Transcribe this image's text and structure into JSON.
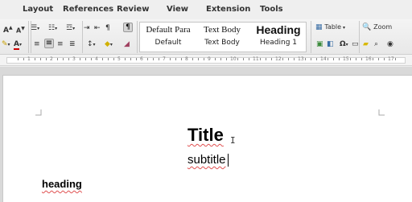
{
  "menubar": {
    "items": [
      "Layout",
      "References",
      "Review",
      "View",
      "Extension",
      "Tools"
    ]
  },
  "toolbar": {
    "font_grow": "A",
    "font_shrink": "A",
    "font_color_label": "A",
    "table_label": "Table",
    "zoom_label": "Zoom",
    "special_char": "Ω",
    "pilcrow": "¶"
  },
  "styles": [
    {
      "preview": "Default Para",
      "name": "Default"
    },
    {
      "preview": "Text Body",
      "name": "Text Body"
    },
    {
      "preview": "Heading",
      "name": "Heading 1"
    }
  ],
  "ruler": {
    "numbers": [
      "1",
      "2",
      "3",
      "4",
      "5",
      "6",
      "7",
      "8",
      "9",
      "10",
      "11",
      "12",
      "13",
      "14",
      "15",
      "16",
      "17"
    ]
  },
  "document": {
    "title": "Title",
    "subtitle": "subtitle",
    "heading": "heading"
  },
  "colors": {
    "highlight": "#ffff00",
    "font_color": "#cc0000",
    "spell_underline": "#e05050"
  }
}
